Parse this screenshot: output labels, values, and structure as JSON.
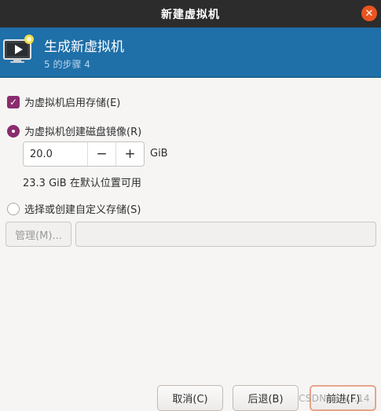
{
  "window": {
    "title": "新建虚拟机",
    "close_glyph": "✕"
  },
  "header": {
    "icon": "vm-monitor-icon",
    "title": "生成新虚拟机",
    "step": "5 的步骤 4"
  },
  "storage": {
    "enable_label": "为虚拟机启用存储(E)",
    "enable_checked": true,
    "create_disk_label": "为虚拟机创建磁盘镜像(R)",
    "create_disk_selected": true,
    "size_value": "20.0",
    "minus_glyph": "−",
    "plus_glyph": "+",
    "size_unit": "GiB",
    "free_space": "23.3 GiB 在默认位置可用",
    "custom_label": "选择或创建自定义存储(S)",
    "custom_selected": false,
    "manage_button": "管理(M)...",
    "path_value": ""
  },
  "footer": {
    "cancel": "取消(C)",
    "back": "后退(B)",
    "forward": "前进(F)"
  },
  "watermark": "CSDN @W...14",
  "colors": {
    "titlebar": "#2c2c2c",
    "banner": "#1f6fa8",
    "accent": "#8a2c6e",
    "close": "#e95420"
  }
}
